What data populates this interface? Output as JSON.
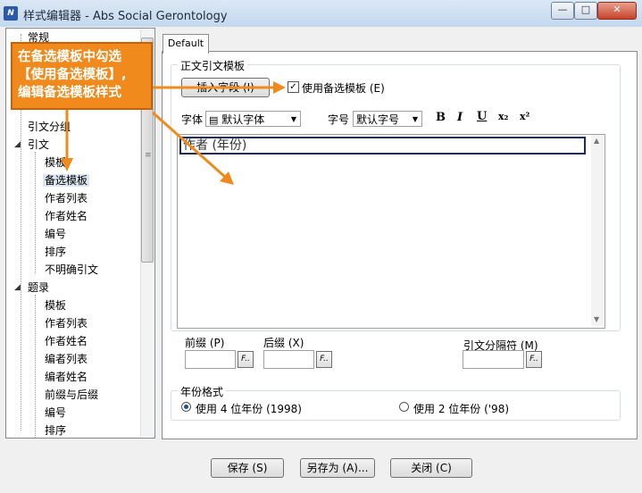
{
  "window": {
    "title": "样式编辑器 - Abs Social Gerontology",
    "icon_text": "N",
    "controls": [
      "minimize-icon",
      "maximize-icon",
      "close-icon"
    ]
  },
  "tree": {
    "items": [
      {
        "label": "常规",
        "level": 0
      },
      {
        "label": "引文分组",
        "level": 0
      },
      {
        "label": "引文",
        "level": 0,
        "expanded": true
      },
      {
        "label": "模板",
        "level": 1
      },
      {
        "label": "备选模板",
        "level": 1,
        "selected": true
      },
      {
        "label": "作者列表",
        "level": 1
      },
      {
        "label": "作者姓名",
        "level": 1
      },
      {
        "label": "编号",
        "level": 1
      },
      {
        "label": "排序",
        "level": 1
      },
      {
        "label": "不明确引文",
        "level": 1
      },
      {
        "label": "题录",
        "level": 0,
        "expanded": true
      },
      {
        "label": "模板",
        "level": 1
      },
      {
        "label": "作者列表",
        "level": 1
      },
      {
        "label": "作者姓名",
        "level": 1
      },
      {
        "label": "编者列表",
        "level": 1
      },
      {
        "label": "编者姓名",
        "level": 1
      },
      {
        "label": "前缀与后缀",
        "level": 1
      },
      {
        "label": "编号",
        "level": 1
      },
      {
        "label": "排序",
        "level": 1
      }
    ]
  },
  "callout": {
    "lines": [
      "在备选模板中勾选",
      "【使用备选模板】,",
      "编辑备选模板样式"
    ],
    "color": "#f08a1c"
  },
  "tab": {
    "label": "Default"
  },
  "template_group": {
    "title": "正文引文模板",
    "insert_field_label": "插入字段 (I)",
    "use_alt_checked": true,
    "use_alt_label": "使用备选模板 (E)",
    "font_label": "字体",
    "font_value": "默认字体",
    "size_label": "字号",
    "size_value": "默认字号",
    "format_buttons": [
      "B",
      "I",
      "U",
      "x₂",
      "x²"
    ],
    "editor_text": "作者 (年份)"
  },
  "affix": {
    "prefix_label": "前缀 (P)",
    "suffix_label": "后缀 (X)",
    "separator_label": "引文分隔符 (M)",
    "field_button": "F.."
  },
  "year_group": {
    "title": "年份格式",
    "option_4": "使用 4 位年份 (1998)",
    "option_2": "使用 2 位年份 ('98)",
    "selected": "option_4"
  },
  "footer": {
    "save": "保存 (S)",
    "save_as": "另存为 (A)...",
    "close": "关闭 (C)"
  }
}
